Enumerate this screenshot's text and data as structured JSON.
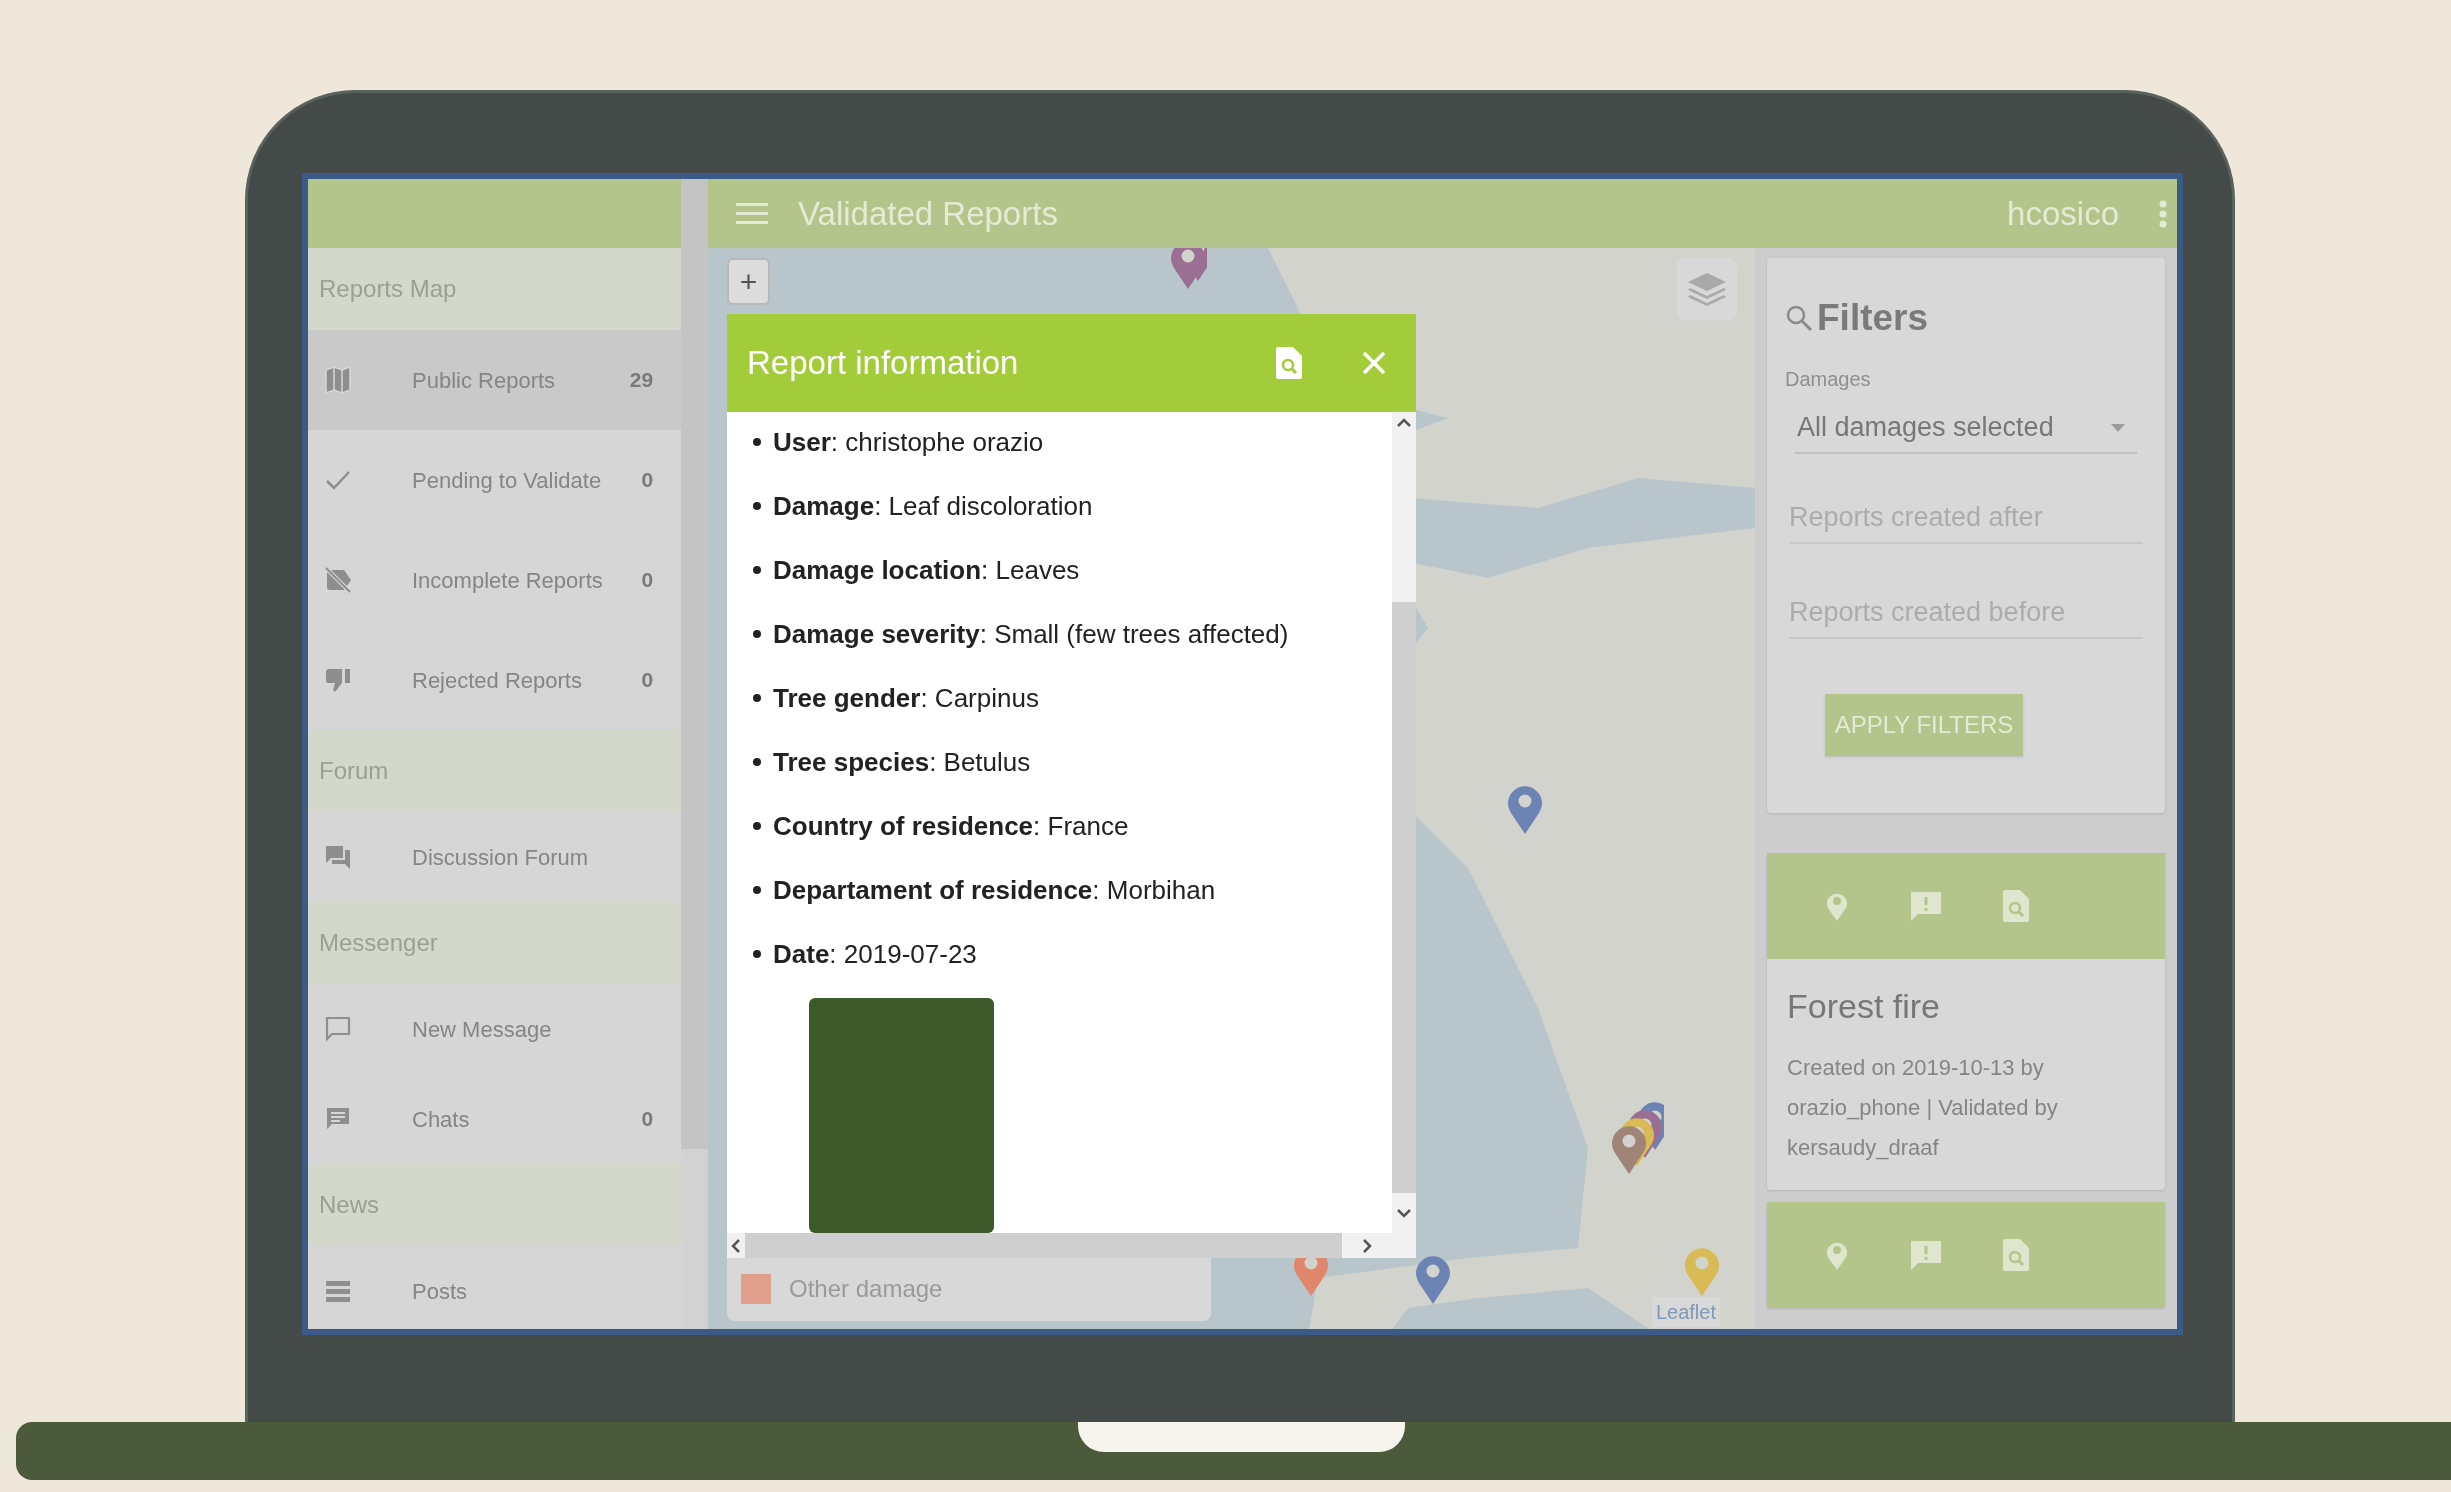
{
  "app_bar": {
    "title": "Validated Reports",
    "user": "hcosico"
  },
  "sidebar": {
    "sections": [
      {
        "heading": "Reports Map",
        "items": [
          {
            "label": "Public Reports",
            "count": "29",
            "selected": true
          },
          {
            "label": "Pending to Validate",
            "count": "0",
            "selected": false
          },
          {
            "label": "Incomplete Reports",
            "count": "0",
            "selected": false
          },
          {
            "label": "Rejected Reports",
            "count": "0",
            "selected": false
          }
        ]
      },
      {
        "heading": "Forum",
        "items": [
          {
            "label": "Discussion Forum",
            "selected": false
          }
        ]
      },
      {
        "heading": "Messenger",
        "items": [
          {
            "label": "New Message",
            "selected": false
          },
          {
            "label": "Chats",
            "count": "0",
            "selected": false
          }
        ]
      },
      {
        "heading": "News",
        "items": [
          {
            "label": "Posts",
            "selected": false
          }
        ]
      }
    ]
  },
  "map": {
    "markers": [
      {
        "pins": [
          {
            "color": "#9b6f93"
          },
          {
            "color": "#9b6f93"
          }
        ]
      },
      {
        "pins": [
          {
            "color": "#6b84b4"
          }
        ]
      },
      {
        "pins": [
          {
            "color": "#6b84b4"
          },
          {
            "color": "#9b6f93"
          },
          {
            "color": "#d9bb55"
          },
          {
            "color": "#a08478"
          }
        ]
      },
      {
        "pins": [
          {
            "color": "#e0866a"
          }
        ]
      },
      {
        "pins": [
          {
            "color": "#6b84b4"
          }
        ]
      },
      {
        "pins": [
          {
            "color": "#d9bb55"
          }
        ]
      }
    ],
    "zoom_in": "+",
    "legend": [
      {
        "label": "Other damage",
        "color": "#e0a08c"
      }
    ],
    "attribution": "Leaflet"
  },
  "dialog": {
    "title": "Report information",
    "fields": [
      "**User**: christophe orazio",
      "**Damage**: Leaf discoloration",
      "**Damage location**: Leaves",
      "**Damage severity**: Small (few trees affected)",
      "**Tree gender**: Carpinus",
      "**Tree species**: Betulus",
      "**Country of residence**: France",
      "**Departament of residence**: Morbihan",
      "**Date**: 2019-07-23"
    ]
  },
  "filters": {
    "title": "Filters",
    "damages_label": "Damages",
    "damages_value": "All damages selected",
    "after_placeholder": "Reports created after",
    "before_placeholder": "Reports created before",
    "button": "APPLY FILTERS"
  },
  "reports": [
    {
      "kind": "full",
      "title": "Forest fire",
      "meta": "Created on 2019-10-13 by orazio_phone | Validated by kersaudy_draaf"
    },
    {
      "kind": "header_only"
    }
  ]
}
